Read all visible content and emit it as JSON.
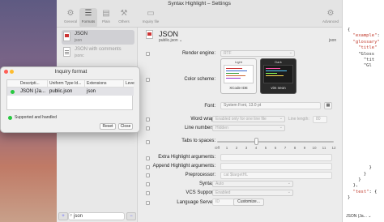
{
  "window": {
    "title": "Syntax Highlight – Settings"
  },
  "toolbar": {
    "items": [
      {
        "label": "General",
        "icon": "gear-icon"
      },
      {
        "label": "Formats",
        "icon": "sliders-icon"
      },
      {
        "label": "Plain",
        "icon": "document-icon"
      },
      {
        "label": "Others",
        "icon": "others-icon"
      },
      {
        "label": "Inquiry file",
        "icon": "inquiry-file-icon"
      },
      {
        "label": "Advanced",
        "icon": "advanced-gear-icon"
      }
    ]
  },
  "sidebar": {
    "items": [
      {
        "name": "JSON",
        "ext": "json"
      },
      {
        "name": "JSON with comments",
        "ext": "jsonc"
      }
    ],
    "search_value": "json",
    "add_glyph": "+",
    "remove_glyph": "−"
  },
  "format": {
    "name": "JSON",
    "subtitle": "public.json ⌄",
    "right_tag": "json"
  },
  "settings": {
    "render_engine_label": "Render engine:",
    "render_engine_value": "RTF",
    "color_scheme_label": "Color scheme:",
    "theme_light_header": "Light",
    "theme_dark_header": "Dark",
    "theme_light_name": "XCode IDE",
    "theme_dark_name": "vim neon",
    "font_label": "Font:",
    "font_value": "System Font, 13.0 pt",
    "word_wrap_label": "Word wrap:",
    "word_wrap_value": "Enabled only for one line file",
    "line_length_label": "Line length:",
    "line_length_value": "80",
    "line_numbers_label": "Line numbers:",
    "line_numbers_value": "Hidden",
    "tabs_label": "Tabs to spaces:",
    "tabs_ticks": [
      "Off",
      "1",
      "2",
      "3",
      "4",
      "5",
      "6",
      "7",
      "8",
      "9",
      "10",
      "11",
      "12"
    ],
    "tabs_value": 4,
    "extra_label": "Extra Highlight arguments:",
    "append_label": "Append Highlight arguments:",
    "preprocessor_label": "Preprocessor:",
    "preprocessor_placeholder": "cat $targetHL",
    "syntax_label": "Syntax:",
    "syntax_value": "Auto",
    "vcs_label": "VCS Support:",
    "vcs_value": "Enabled",
    "language_server_label": "Language Server:",
    "language_server_value": "ID",
    "customize_label": "Customize..."
  },
  "preview": {
    "lines": [
      "{",
      "  \"example\":",
      "  \"glossary\"",
      "    \"title\"",
      "    \"Gloss",
      "      \"tit",
      "      \"Gl",
      "",
      "",
      "",
      "",
      "",
      "",
      "",
      "",
      "",
      "",
      "",
      "",
      "",
      "",
      "",
      "",
      "        }",
      "      }",
      "    }",
      "  },",
      "  \"test\": {",
      "}"
    ],
    "footer": "JSON (Ja... ⌄"
  },
  "dialog": {
    "title": "Inquiry format",
    "columns": [
      "Descripti...",
      "Uniform Type Id...",
      "Extensions",
      "Leve"
    ],
    "row": {
      "description": "JSON (Ja...",
      "uti": "public.json",
      "ext": "json",
      "level": ""
    },
    "status": "Supported and handled",
    "reset": "Reset",
    "close": "Close"
  },
  "colors": {
    "accent_red": "#cc3333",
    "success_green": "#28c840",
    "close_red": "#ff5f57",
    "minimize_yellow": "#febc2e"
  }
}
